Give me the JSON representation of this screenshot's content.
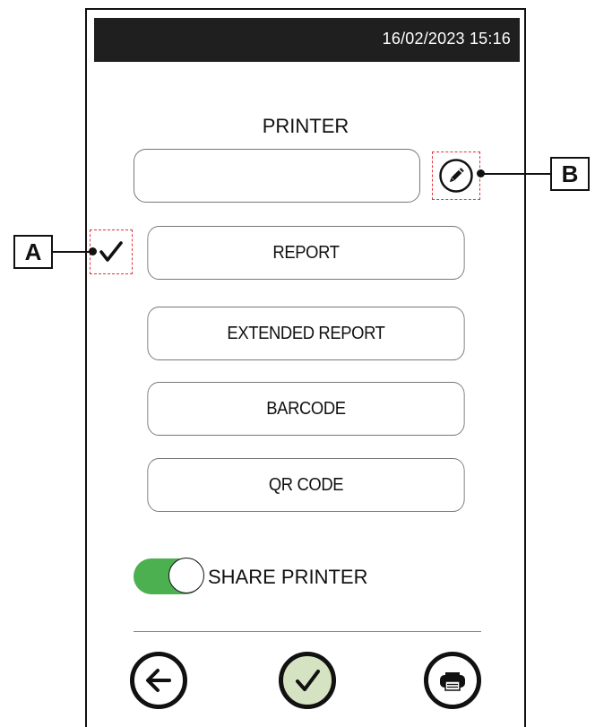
{
  "status_bar": {
    "datetime": "16/02/2023 15:16"
  },
  "page": {
    "title": "PRINTER"
  },
  "printer_field": {
    "value": ""
  },
  "options": [
    {
      "label": "REPORT",
      "checked": true
    },
    {
      "label": "EXTENDED REPORT",
      "checked": false
    },
    {
      "label": "BARCODE",
      "checked": false
    },
    {
      "label": "QR CODE",
      "checked": false
    }
  ],
  "share_toggle": {
    "label": "SHARE PRINTER",
    "on": true
  },
  "callouts": {
    "a": "A",
    "b": "B"
  },
  "nav": {
    "back_icon": "arrow-left-icon",
    "confirm_icon": "check-icon",
    "print_icon": "printer-icon"
  },
  "colors": {
    "status_bar_bg": "#1f1f1f",
    "toggle_on": "#4caf50",
    "confirm_fill": "#d6e3c2",
    "highlight_dash": "#e0343c"
  }
}
